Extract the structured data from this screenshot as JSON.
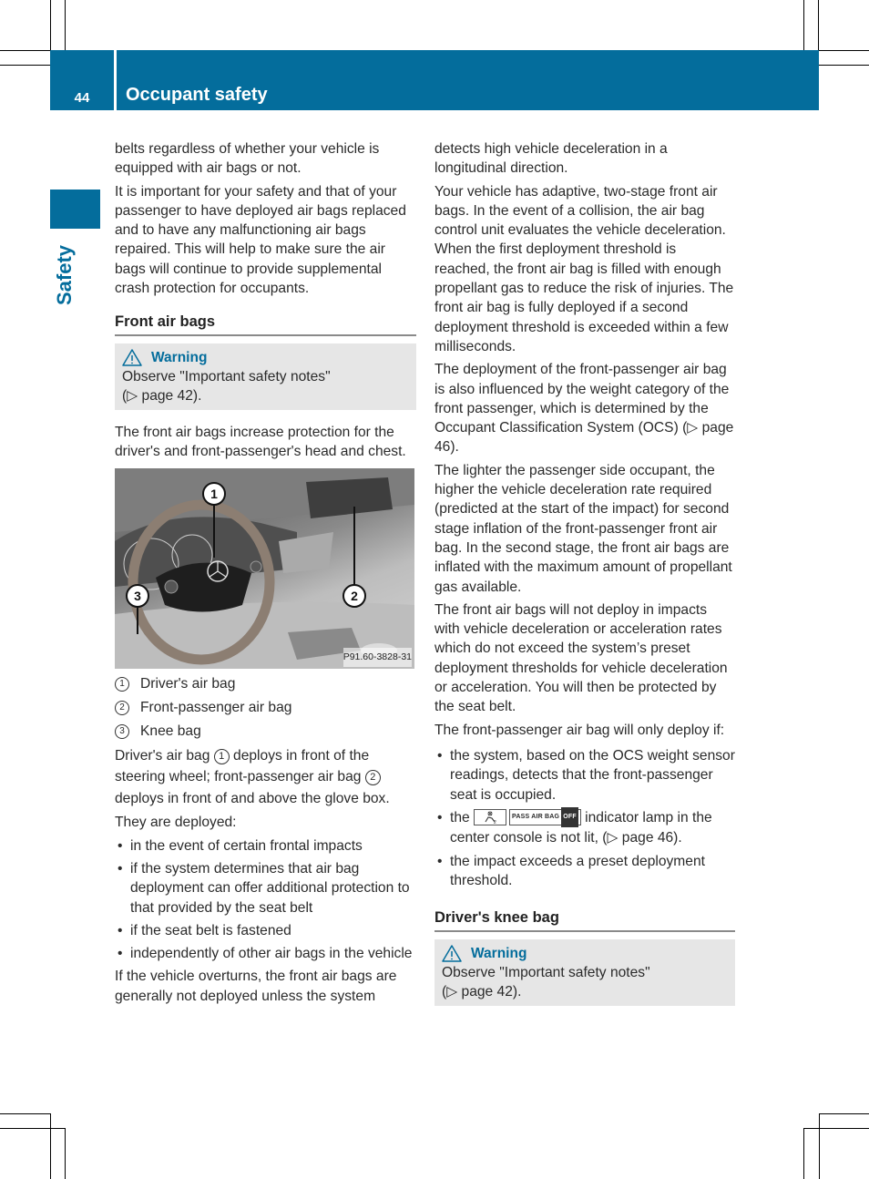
{
  "header": {
    "page_number": "44",
    "title": "Occupant safety"
  },
  "side_tab": {
    "label": "Safety"
  },
  "colors": {
    "brand_blue": "#046d9c",
    "warning_bg": "#e6e6e6"
  },
  "left_column": {
    "para1": "belts regardless of whether your vehicle is equipped with air bags or not.",
    "para2": "It is important for your safety and that of your passenger to have deployed air bags replaced and to have any malfunctioning air bags repaired. This will help to make sure the air bags will continue to provide supplemental crash protection for occupants.",
    "section_heading": "Front air bags",
    "warning": {
      "icon": "warning-triangle-icon",
      "title": "Warning",
      "line1": "Observe \"Important safety notes\"",
      "line2": "(▷ page 42)."
    },
    "para3": "The front air bags increase protection for the driver's and front-passenger's head and chest.",
    "figure": {
      "callouts": [
        "1",
        "2",
        "3"
      ],
      "code": "P91.60-3828-31"
    },
    "legend": [
      {
        "num": "1",
        "label": "Driver's air bag"
      },
      {
        "num": "2",
        "label": "Front-passenger air bag"
      },
      {
        "num": "3",
        "label": "Knee bag"
      }
    ],
    "para4": {
      "part1": "Driver's air bag ",
      "ref1": "1",
      "part2": " deploys in front of the steering wheel; front-passenger air bag ",
      "ref2": "2",
      "part3": " deploys in front of and above the glove box."
    },
    "para5": "They are deployed:",
    "bullets": [
      "in the event of certain frontal impacts",
      "if the system determines that air bag deployment can offer additional protection to that provided by the seat belt",
      "if the seat belt is fastened",
      "independently of other air bags in the vehicle"
    ],
    "para6": "If the vehicle overturns, the front air bags are generally not deployed unless the system"
  },
  "right_column": {
    "para1": "detects high vehicle deceleration in a longitudinal direction.",
    "para2": "Your vehicle has adaptive, two-stage front air bags. In the event of a collision, the air bag control unit evaluates the vehicle deceleration. When the first deployment threshold is reached, the front air bag is filled with enough propellant gas to reduce the risk of injuries. The front air bag is fully deployed if a second deployment threshold is exceeded within a few milliseconds.",
    "para3": "The deployment of the front-passenger air bag is also influenced by the weight category of the front passenger, which is determined by the Occupant Classification System (OCS) (▷ page 46).",
    "para4": "The lighter the passenger side occupant, the higher the vehicle deceleration rate required (predicted at the start of the impact) for second stage inflation of the front-passenger front air bag. In the second stage, the front air bags are inflated with the maximum amount of propellant gas available.",
    "para5": "The front air bags will not deploy in impacts with vehicle deceleration or acceleration rates which do not exceed the system’s preset deployment thresholds for vehicle deceleration or acceleration. You will then be protected by the seat belt.",
    "para6": "The front-passenger air bag will only deploy if:",
    "bullets": {
      "b1": "the system, based on the OCS weight sensor readings, detects that the front-passenger seat is occupied.",
      "b2_pre": "the ",
      "b2_lamp_text": "PASS AIR BAG",
      "b2_lamp_off": "OFF",
      "b2_post": " indicator lamp in the center console is not lit, (▷ page 46).",
      "b3": "the impact exceeds a preset deployment threshold."
    },
    "section_heading": "Driver's knee bag",
    "warning": {
      "icon": "warning-triangle-icon",
      "title": "Warning",
      "line1": "Observe \"Important safety notes\"",
      "line2": "(▷ page 42)."
    }
  }
}
